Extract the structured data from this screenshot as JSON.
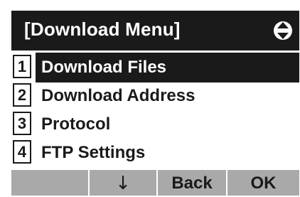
{
  "header": {
    "title": "[Download Menu]",
    "scroll_icon": "up-down-navigation-icon"
  },
  "menu": {
    "items": [
      {
        "number": "1",
        "label": "Download Files",
        "selected": true
      },
      {
        "number": "2",
        "label": "Download Address",
        "selected": false
      },
      {
        "number": "3",
        "label": "Protocol",
        "selected": false
      },
      {
        "number": "4",
        "label": "FTP Settings",
        "selected": false
      }
    ]
  },
  "softkeys": {
    "key1": "",
    "key2": "↓",
    "key3": "Back",
    "key4": "OK"
  },
  "colors": {
    "title_background": "#1a1a1a",
    "selected_background": "#1a1a1a",
    "softkey_background": "#a9a9a9",
    "text": "#1a1a1a"
  }
}
